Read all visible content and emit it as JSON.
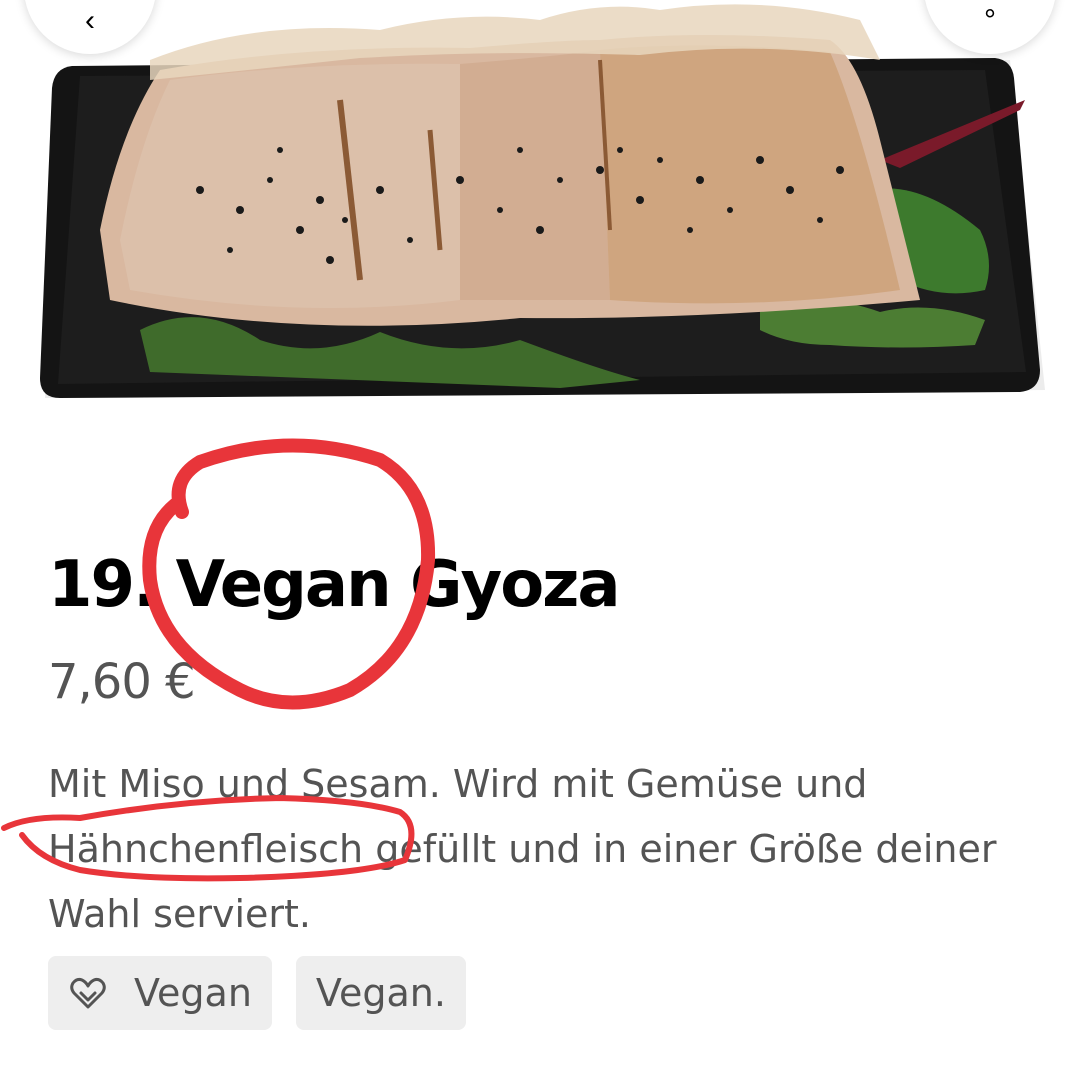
{
  "product": {
    "title": "19. Vegan Gyoza",
    "price": "7,60 €",
    "description": "Mit Miso und Sesam. Wird mit Gemüse und Hähnchenfleisch gefüllt und in einer Größe deiner Wahl serviert.",
    "image_icon": "food-photo"
  },
  "nav": {
    "back_icon": "back-arrow-icon",
    "right_icon": "action-icon"
  },
  "tags": [
    {
      "label": "Vegan",
      "icon": "heart-icon"
    },
    {
      "label": "Vegan."
    }
  ],
  "colors": {
    "title": "#000000",
    "secondary_text": "#545454",
    "tag_background": "#eeeeee",
    "annotation": "#e8353a"
  }
}
